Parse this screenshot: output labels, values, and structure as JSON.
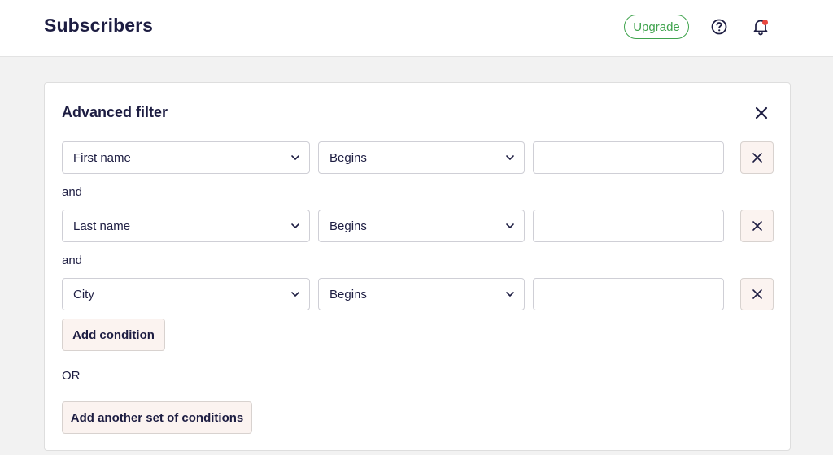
{
  "header": {
    "title": "Subscribers",
    "upgrade_label": "Upgrade",
    "help_icon": "help-circle-icon",
    "bell_icon": "bell-icon",
    "notification_dot_color": "#e8473f"
  },
  "filter": {
    "title": "Advanced filter",
    "close_icon": "close-icon",
    "conditions": [
      {
        "field": "First name",
        "operator": "Begins",
        "value": ""
      },
      {
        "field": "Last name",
        "operator": "Begins",
        "value": ""
      },
      {
        "field": "City",
        "operator": "Begins",
        "value": ""
      }
    ],
    "joiners": [
      "and",
      "and"
    ],
    "add_condition_label": "Add condition",
    "or_label": "OR",
    "add_set_label": "Add another set of conditions"
  },
  "colors": {
    "accent_green": "#3fa34d",
    "text_dark": "#1d1d42",
    "button_bg": "#fbf3f0"
  }
}
